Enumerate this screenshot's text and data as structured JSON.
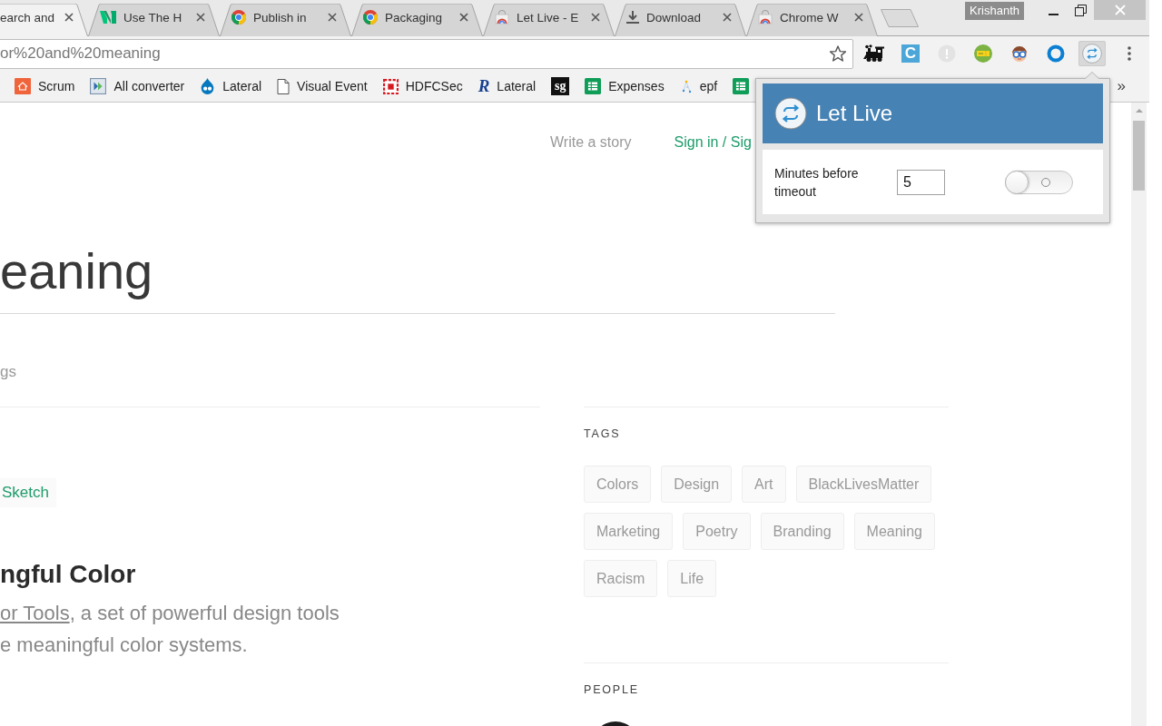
{
  "window": {
    "profile": "Krishanth"
  },
  "tabs": [
    {
      "title": "earch and",
      "kind": "none",
      "selected": true
    },
    {
      "title": "Use The H",
      "kind": "logo",
      "selected": false
    },
    {
      "title": "Publish in",
      "kind": "browser",
      "selected": false
    },
    {
      "title": "Packaging",
      "kind": "browser",
      "selected": false
    },
    {
      "title": "Let Live - E",
      "kind": "bag",
      "selected": false
    },
    {
      "title": "Download",
      "kind": "download",
      "selected": false
    },
    {
      "title": "Chrome W",
      "kind": "bag",
      "selected": false
    }
  ],
  "toolbar": {
    "address": "or%20and%20meaning",
    "extensions": [
      {
        "kind": "train",
        "selected": false
      },
      {
        "kind": "letter",
        "label": "C",
        "selected": false
      },
      {
        "kind": "alert",
        "selected": false
      },
      {
        "kind": "ticket",
        "selected": false
      },
      {
        "kind": "face",
        "selected": false
      },
      {
        "kind": "ring",
        "selected": false
      },
      {
        "kind": "loop",
        "selected": true
      }
    ]
  },
  "bookmarks": {
    "items": [
      {
        "kind": "house",
        "label": "Scrum"
      },
      {
        "kind": "chevrons",
        "label": "All converter"
      },
      {
        "kind": "drop",
        "label": "Lateral"
      },
      {
        "kind": "page",
        "label": "Visual Event"
      },
      {
        "kind": "square",
        "label": "HDFCSec"
      },
      {
        "kind": "letter",
        "mark": "R",
        "label": "Lateral"
      },
      {
        "kind": "tile",
        "mark": "sg"
      },
      {
        "kind": "sheet",
        "label": "Expenses"
      },
      {
        "kind": "dots",
        "label": "epf"
      },
      {
        "kind": "sheet"
      }
    ],
    "overflow": "»"
  },
  "page": {
    "header_links": [
      {
        "label": "Write a story",
        "kind": "plain"
      },
      {
        "label": "Sign in / Sig",
        "kind": "accent"
      }
    ],
    "title": "eaning",
    "section_label": "gs",
    "story": {
      "tag": "Sketch",
      "title": "ngful Color",
      "link": "or Tools",
      "lines": [
        ", a set of powerful design tools",
        "e meaningful color systems."
      ]
    },
    "sidebar": {
      "tags_heading": "TAGS",
      "tags": [
        "Colors",
        "Design",
        "Art",
        "BlackLivesMatter",
        "Marketing",
        "Poetry",
        "Branding",
        "Meaning",
        "Racism",
        "Life"
      ],
      "people_heading": "PEOPLE"
    }
  },
  "popup": {
    "title": "Let Live",
    "label": "Minutes before timeout",
    "value": "5",
    "enabled": false
  }
}
